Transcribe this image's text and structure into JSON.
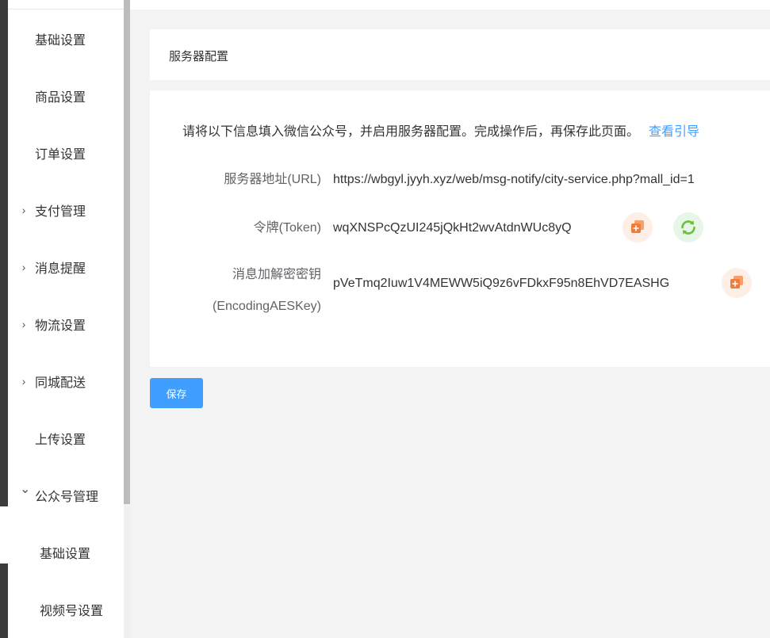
{
  "sidebar": {
    "items": [
      {
        "label": "基础设置",
        "arrow": ""
      },
      {
        "label": "商品设置",
        "arrow": ""
      },
      {
        "label": "订单设置",
        "arrow": ""
      },
      {
        "label": "支付管理",
        "arrow": "›"
      },
      {
        "label": "消息提醒",
        "arrow": "›"
      },
      {
        "label": "物流设置",
        "arrow": "›"
      },
      {
        "label": "同城配送",
        "arrow": "›"
      },
      {
        "label": "上传设置",
        "arrow": ""
      },
      {
        "label": "公众号管理",
        "arrow": "⌄"
      }
    ],
    "subitems": [
      {
        "label": "基础设置"
      },
      {
        "label": "视频号设置"
      }
    ]
  },
  "card": {
    "title": "服务器配置",
    "notice": "请将以下信息填入微信公众号，并启用服务器配置。完成操作后，再保存此页面。",
    "notice_link": "查看引导",
    "url_label": "服务器地址(URL)",
    "url_value": "https://wbgyl.jyyh.xyz/web/msg-notify/city-service.php?mall_id=1",
    "token_label": "令牌(Token)",
    "token_value": "wqXNSPcQzUI245jQkHt2wvAtdnWUc8yQ",
    "aes_label_line1": "消息加解密密钥",
    "aes_label_line2": "(EncodingAESKey)",
    "aes_value": "pVeTmq2Iuw1V4MEWW5iQ9z6vFDkxF95n8EhVD7EASHG"
  },
  "actions": {
    "save_label": "保存"
  },
  "colors": {
    "accent": "#409eff",
    "copy_icon": "#f07c3c",
    "refresh_icon": "#67c23a"
  }
}
